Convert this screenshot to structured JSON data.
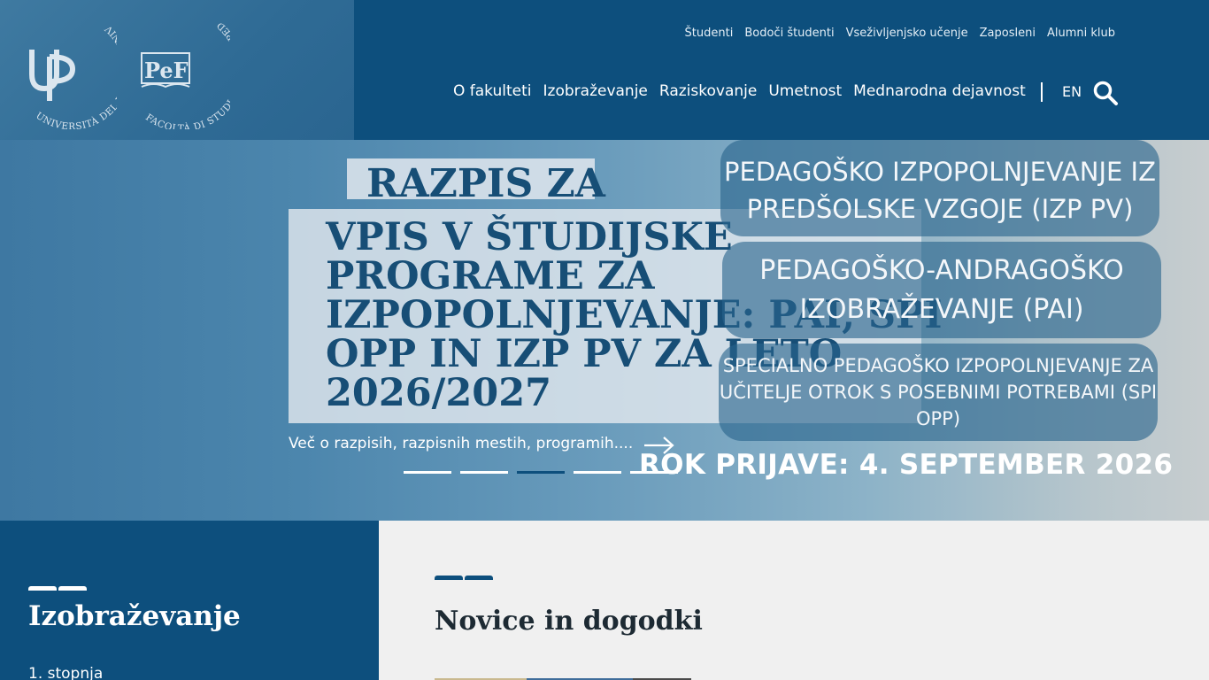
{
  "header": {
    "logo_up_text": "UNIVERSITÀ DEL LITORALE UNIVERZA NA PRIMORSKEM",
    "logo_pef_text": "FACOLTÀ DI STUDI EDUCATIVI PEDAGOŠKA FAKULTETA",
    "top_links": [
      {
        "label": "Študenti"
      },
      {
        "label": "Bodoči študenti"
      },
      {
        "label": "Vseživljenjsko učenje"
      },
      {
        "label": "Zaposleni"
      },
      {
        "label": "Alumni klub"
      }
    ],
    "main_nav": [
      {
        "label": "O fakulteti"
      },
      {
        "label": "Izobraževanje"
      },
      {
        "label": "Raziskovanje"
      },
      {
        "label": "Umetnost"
      },
      {
        "label": "Mednarodna dejavnost"
      }
    ],
    "separator": "|",
    "language": "EN",
    "search_icon": "search-icon"
  },
  "hero": {
    "title_line1": "RAZPIS ZA",
    "title_rest": "VPIS V ŠTUDIJSKE PROGRAME ZA IZPOPOLNJEVANJE: PAI, SPI OPP IN IZP PV ZA LETO 2026/2027",
    "pill_1": "PEDAGOŠKO IZPOPOLNJEVANJE IZ PREDŠOLSKE VZGOJE (IZP PV)",
    "pill_2": "PEDAGOŠKO-ANDRAGOŠKO IZOBRAŽEVANJE (PAI)",
    "pill_3": "SPECIALNO PEDAGOŠKO IZPOPOLNJEVANJE ZA UČITELJE OTROK S POSEBNIMI POTREBAMI (SPI OPP)",
    "deadline": "ROK PRIJAVE: 4. SEPTEMBER 2026",
    "more_link": "Več o razpisih, razpisnih mestih, programih....",
    "slides_total": 5,
    "slide_active": 3
  },
  "education": {
    "title": "Izobraževanje",
    "first_link": "1. stopnja"
  },
  "news": {
    "title": "Novice in dogodki"
  },
  "colors": {
    "primary": "#0d4f7d",
    "hero_text": "#174e76",
    "background": "#f0f0f0"
  }
}
